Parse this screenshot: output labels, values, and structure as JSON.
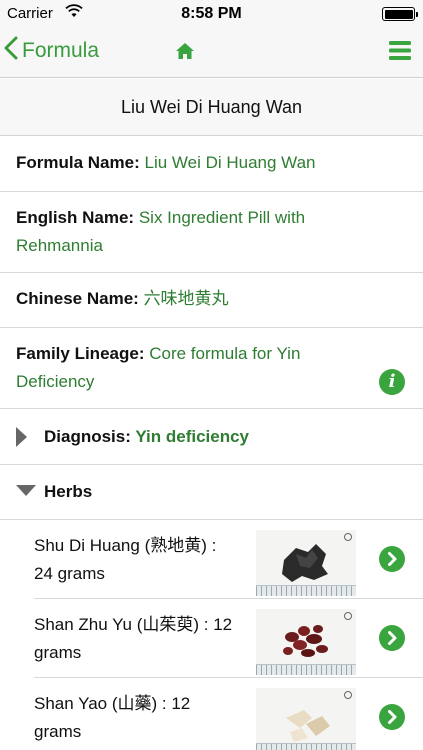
{
  "status_bar": {
    "carrier": "Carrier",
    "time": "8:58 PM"
  },
  "nav": {
    "back_label": "Formula",
    "home_icon": "home-icon",
    "menu_icon": "hamburger-menu-icon"
  },
  "title": "Liu Wei Di Huang Wan",
  "fields": {
    "formula_name": {
      "label": "Formula Name:",
      "value": "Liu Wei Di Huang Wan"
    },
    "english_name": {
      "label": "English Name:",
      "value_line1": "Six Ingredient Pill with",
      "value_line2": "Rehmannia"
    },
    "chinese_name": {
      "label": "Chinese Name:",
      "value": "六味地黄丸"
    },
    "family_lineage": {
      "label": "Family Lineage:",
      "value_line1": "Core formula for Yin",
      "value_line2": "Deficiency"
    }
  },
  "diagnosis": {
    "label": "Diagnosis:",
    "value": "Yin deficiency"
  },
  "herbs": {
    "label": "Herbs",
    "items": [
      {
        "line1": "Shu Di Huang (熟地黄) :",
        "line2": "24 grams"
      },
      {
        "line1": "Shan Zhu Yu (山茱萸) : 12",
        "line2": "grams"
      },
      {
        "line1": "Shan Yao (山藥) : 12",
        "line2": "grams"
      }
    ]
  },
  "colors": {
    "accent": "#3aa53f",
    "value_text": "#2e7d32",
    "bar_bg": "#f7f7f7"
  }
}
